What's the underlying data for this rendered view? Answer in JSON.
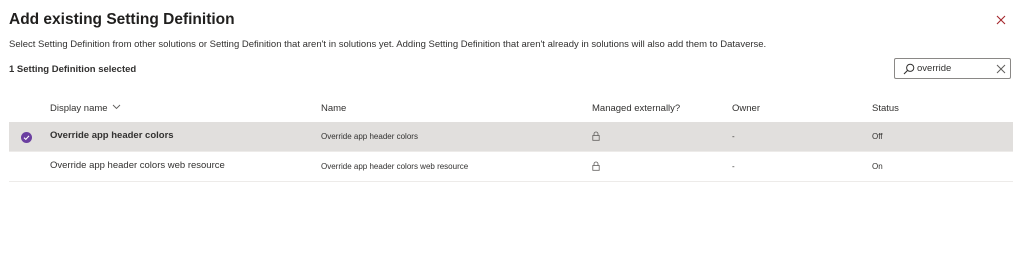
{
  "dialog": {
    "title": "Add existing Setting Definition",
    "description": "Select Setting Definition from other solutions or Setting Definition that aren't in solutions yet. Adding Setting Definition that aren't already in solutions will also add them to Dataverse.",
    "selection_count": "1 Setting Definition selected"
  },
  "search": {
    "value": "override",
    "placeholder": "Search"
  },
  "grid": {
    "columns": {
      "display_name": "Display name",
      "name": "Name",
      "managed_externally": "Managed externally?",
      "owner": "Owner",
      "status": "Status"
    },
    "rows": [
      {
        "selected": true,
        "display_name": "Override app header colors",
        "name": "Override app header colors",
        "managed_externally_icon": "lock-icon",
        "owner": "-",
        "status": "Off"
      },
      {
        "selected": false,
        "display_name": "Override app header colors web resource",
        "name": "Override app header colors web resource",
        "managed_externally_icon": "lock-icon",
        "owner": "-",
        "status": "On"
      }
    ]
  },
  "colors": {
    "accent": "#6b3fa0",
    "selected_row": "#e1dfdd"
  }
}
